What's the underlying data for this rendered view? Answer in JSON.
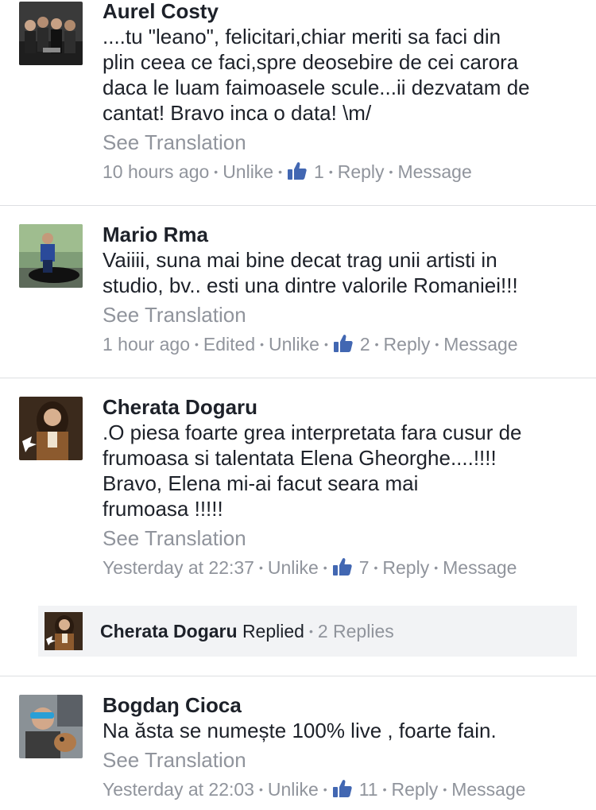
{
  "comments": [
    {
      "name": "Aurel Costy",
      "text": "....tu \"leano\", felicitari,chiar meriti sa faci din\nplin ceea ce faci,spre deosebire de cei carora\ndaca le luam faimoasele scule...ii dezvatam de\ncantat! Bravo inca o data! \\m/",
      "see_translation": "See Translation",
      "time": "10 hours ago",
      "edited": null,
      "unlike": "Unlike",
      "likes": "1",
      "reply": "Reply",
      "message": "Message"
    },
    {
      "name": "Mario Rma",
      "text": "Vaiiii, suna mai bine decat trag unii artisti in\nstudio, bv.. esti una dintre valorile Romaniei!!!",
      "see_translation": "See Translation",
      "time": "1 hour ago",
      "edited": "Edited",
      "unlike": "Unlike",
      "likes": "2",
      "reply": "Reply",
      "message": "Message"
    },
    {
      "name": "Cherata Dogaru",
      "text": ".O piesa foarte grea interpretata fara cusur de\nfrumoasa si talentata Elena Gheorghe....!!!!\nBravo, Elena mi-ai facut seara mai\nfrumoasa !!!!!",
      "see_translation": "See Translation",
      "time": "Yesterday at 22:37",
      "edited": null,
      "unlike": "Unlike",
      "likes": "7",
      "reply": "Reply",
      "message": "Message"
    },
    {
      "name": "Bogdaŋ Cioca",
      "text": "Na ăsta se numește 100% live , foarte fain.",
      "see_translation": "See Translation",
      "time": "Yesterday at 22:03",
      "edited": null,
      "unlike": "Unlike",
      "likes": "11",
      "reply": "Reply",
      "message": "Message"
    }
  ],
  "reply_summary": {
    "name": "Cherata Dogaru",
    "action": "Replied",
    "count": "2 Replies"
  },
  "colors": {
    "text": "#1d2129",
    "meta": "#90949c",
    "like_blue": "#4267b2",
    "divider": "#dddfe2",
    "reply_bg": "#f2f3f5"
  }
}
